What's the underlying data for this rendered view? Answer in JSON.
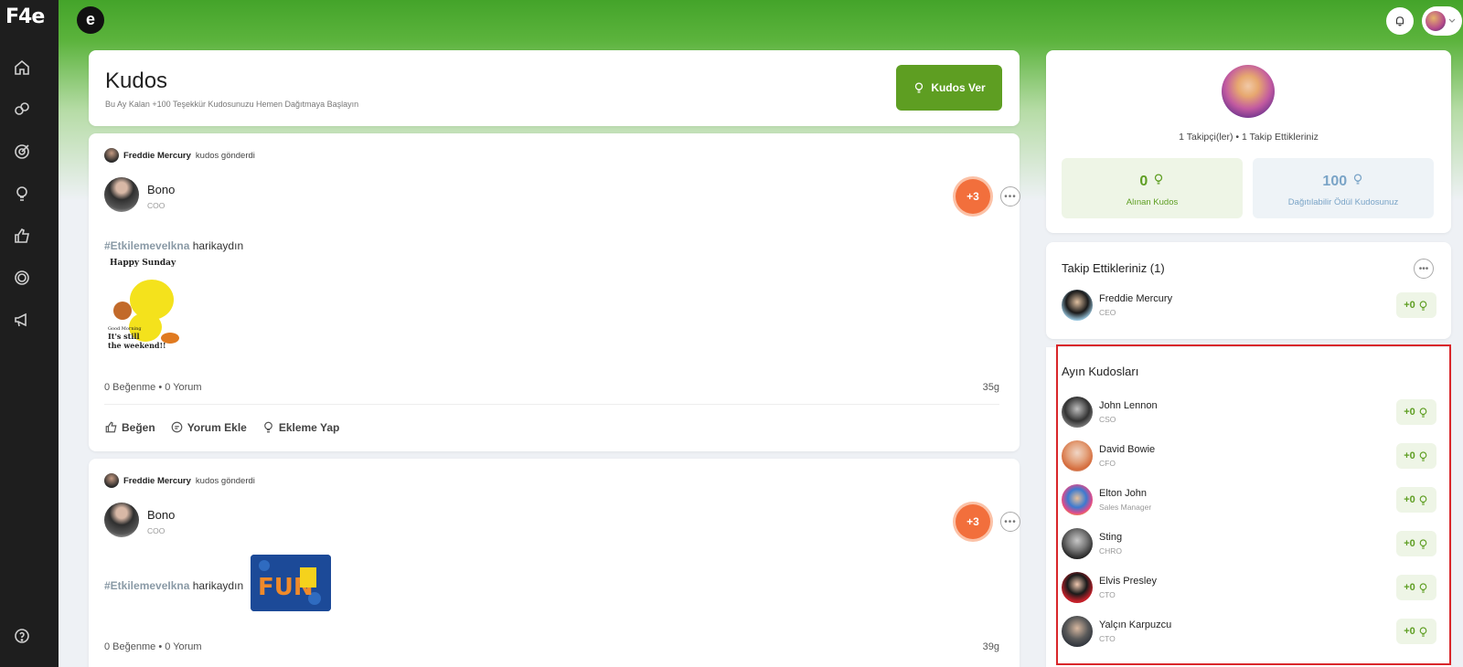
{
  "app": {
    "logo": "F4e",
    "brand": "e"
  },
  "nav": [
    {
      "icon": "home-icon"
    },
    {
      "icon": "people-icon"
    },
    {
      "icon": "target-icon"
    },
    {
      "icon": "bulb-icon"
    },
    {
      "icon": "thumbs-up-icon"
    },
    {
      "icon": "ring-icon"
    },
    {
      "icon": "megaphone-icon"
    },
    {
      "icon": "help-icon"
    }
  ],
  "header": {
    "title": "Kudos",
    "subtitle": "Bu Ay Kalan +100 Teşekkür Kudosunuzu Hemen Dağıtmaya Başlayın",
    "button_label": "Kudos Ver"
  },
  "posts": [
    {
      "sender": "Freddie Mercury",
      "sent_text": "kudos gönderdi",
      "recipient_name": "Bono",
      "recipient_title": "COO",
      "badge": "+3",
      "hashtag": "#EtkilemeveIkna",
      "message": "harikaydın",
      "image": {
        "line1": "Happy Sunday",
        "line2": "Good Morning",
        "line3": "It's still",
        "line4": "the weekend!!"
      },
      "stats": "0 Beğenme • 0 Yorum",
      "ago": "35g",
      "actions": {
        "like": "Beğen",
        "comment": "Yorum Ekle",
        "add": "Ekleme Yap"
      }
    },
    {
      "sender": "Freddie Mercury",
      "sent_text": "kudos gönderdi",
      "recipient_name": "Bono",
      "recipient_title": "COO",
      "badge": "+3",
      "hashtag": "#EtkilemeveIkna",
      "message": "harikaydın",
      "image_text": "FUN",
      "stats": "0 Beğenme • 0 Yorum",
      "ago": "39g"
    }
  ],
  "profile": {
    "follow_text": "1 Takipçi(ler) • 1 Takip Ettikleriniz",
    "received_value": "0",
    "received_label": "Alınan Kudos",
    "distributable_value": "100",
    "distributable_label": "Dağıtılabilir Ödül Kudosunuz"
  },
  "following": {
    "title": "Takip Ettikleriniz (1)",
    "people": [
      {
        "name": "Freddie Mercury",
        "title": "CEO",
        "kudo": "+0"
      }
    ]
  },
  "month": {
    "title": "Ayın Kudosları",
    "people": [
      {
        "name": "John Lennon",
        "title": "CSO",
        "kudo": "+0"
      },
      {
        "name": "David Bowie",
        "title": "CFO",
        "kudo": "+0"
      },
      {
        "name": "Elton John",
        "title": "Sales Manager",
        "kudo": "+0"
      },
      {
        "name": "Sting",
        "title": "CHRO",
        "kudo": "+0"
      },
      {
        "name": "Elvis Presley",
        "title": "CTO",
        "kudo": "+0"
      },
      {
        "name": "Yalçın Karpuzcu",
        "title": "CTO",
        "kudo": "+0"
      }
    ]
  },
  "colors": {
    "accent": "#5e9e22",
    "badge": "#f26f3c",
    "sidebar": "#1e1e1e",
    "highlight": "#d9262a"
  }
}
